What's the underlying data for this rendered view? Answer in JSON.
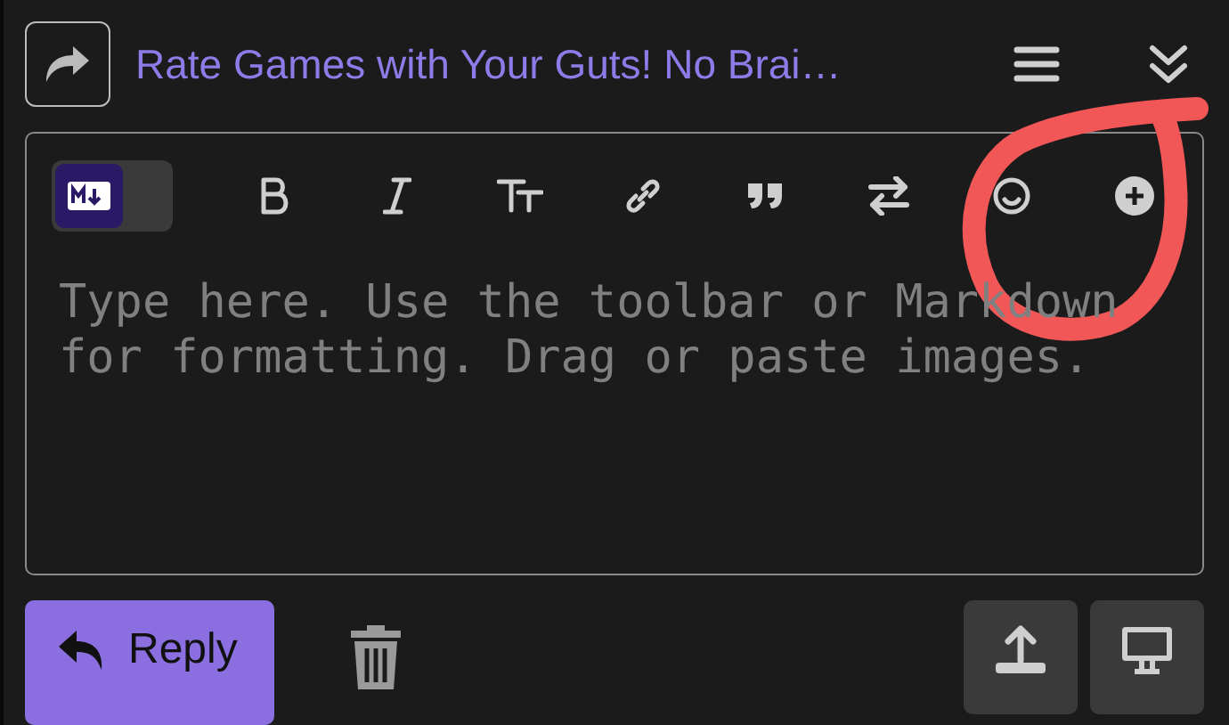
{
  "header": {
    "title": "Rate Games with Your Guts! No Brai…"
  },
  "editor": {
    "markdown_mode_on": true,
    "placeholder": "Type here. Use the toolbar or Markdown for formatting. Drag or paste images."
  },
  "footer": {
    "reply_button": "Reply"
  }
}
